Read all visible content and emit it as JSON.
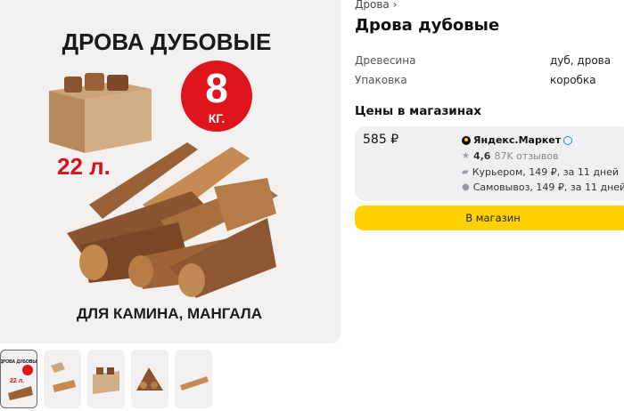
{
  "image": {
    "headline": "ДРОВА ДУБОВЫЕ",
    "weight_number": "8",
    "weight_unit": "КГ.",
    "volume": "22 л.",
    "footer": "ДЛЯ КАМИНА, МАНГАЛА"
  },
  "breadcrumb": "Дрова ›",
  "title": "Дрова дубовые",
  "specs": [
    {
      "label": "Древесина",
      "value": "дуб, дрова"
    },
    {
      "label": "Упаковка",
      "value": "коробка"
    }
  ],
  "prices_title": "Цены в магазинах",
  "offer": {
    "price": "585 ₽",
    "shop": "Яндекс.Маркет",
    "rating": "4,6",
    "reviews": "87K отзывов",
    "courier": "Курьером, 149 ₽, за 11 дней",
    "pickup": "Самовывоз, 149 ₽, за 11 дней"
  },
  "button": "В магазин",
  "thumbs": [
    "thumb-1",
    "thumb-2",
    "thumb-3",
    "thumb-4",
    "thumb-5"
  ],
  "colors": {
    "accent_yellow": "#ffd100",
    "badge_red": "#e0141c",
    "text_red": "#d4121a"
  },
  "icons": {
    "star": "star-icon",
    "truck": "truck-icon",
    "pin": "pin-icon",
    "check": "verified-icon"
  }
}
